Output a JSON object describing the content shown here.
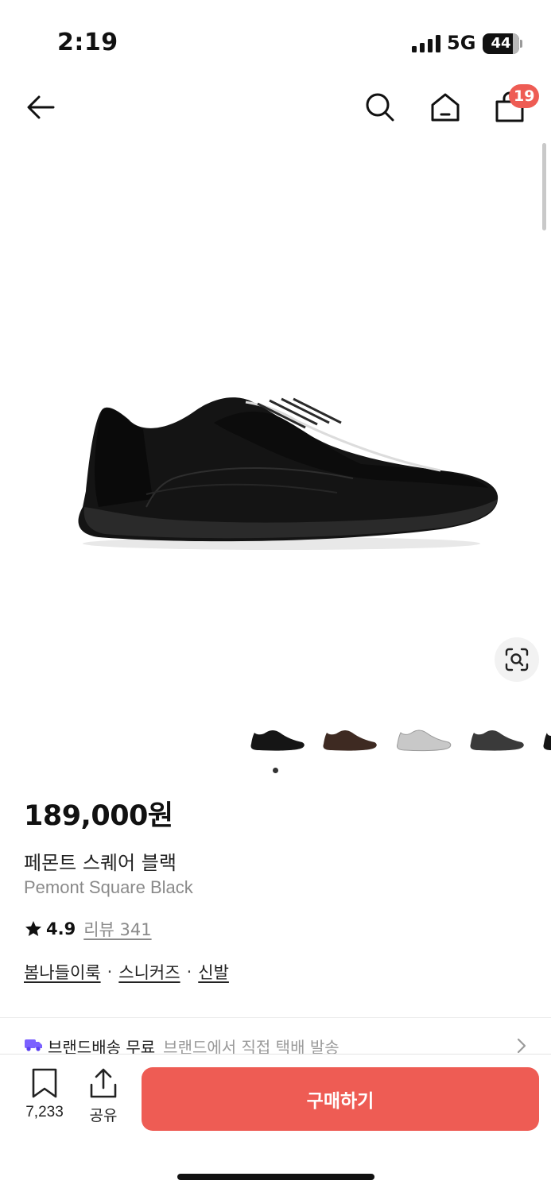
{
  "status_bar": {
    "time": "2:19",
    "network": "5G",
    "battery": "44"
  },
  "nav": {
    "back_icon": "arrow-left-icon",
    "search_icon": "search-icon",
    "home_icon": "home-icon",
    "cart_icon": "shopping-bag-icon",
    "cart_count": "19"
  },
  "product": {
    "price": "189,000원",
    "name_ko": "페몬트 스퀘어 블랙",
    "name_en": "Pemont Square Black",
    "rating": "4.9",
    "review_label": "리뷰 341",
    "breadcrumbs": [
      "봄나들이룩",
      "스니커즈",
      "신발"
    ],
    "breadcrumb_separator": "·",
    "thumbnails": [
      "black",
      "brown",
      "silver",
      "dark-gray"
    ]
  },
  "shipping": {
    "icon": "truck-icon",
    "title": "브랜드배송 무료",
    "subtitle": "브랜드에서 직접 택배 발송"
  },
  "bottom_bar": {
    "bookmark_count": "7,233",
    "share_label": "공유",
    "buy_label": "구매하기"
  },
  "colors": {
    "accent": "#ee5c54",
    "badge": "#ee5c54",
    "truck": "#7b61ff"
  }
}
